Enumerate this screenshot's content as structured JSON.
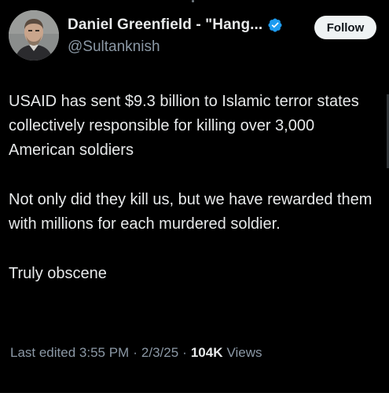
{
  "tweet": {
    "author": {
      "display_name": "Daniel Greenfield - \"Hang...",
      "handle": "@Sultanknish",
      "verified_icon": "verified-badge-icon",
      "avatar_icon": "avatar-photo"
    },
    "follow_label": "Follow",
    "paragraphs": [
      "USAID has sent $9.3 billion to Islamic terror states collectively responsible for killing over 3,000 American soldiers",
      "Not only did they kill us, but we have rewarded them with millions for each murdered soldier.",
      "Truly obscene"
    ],
    "meta": {
      "edited_label": "Last edited 3:55 PM",
      "date": "2/3/25",
      "views_count": "104K",
      "views_label": "Views",
      "separator": "·"
    }
  },
  "colors": {
    "background": "#000000",
    "text_primary": "#e7e9ea",
    "text_secondary": "#8b98a5",
    "verified_blue": "#1d9bf0",
    "follow_bg": "#eff3f4"
  }
}
